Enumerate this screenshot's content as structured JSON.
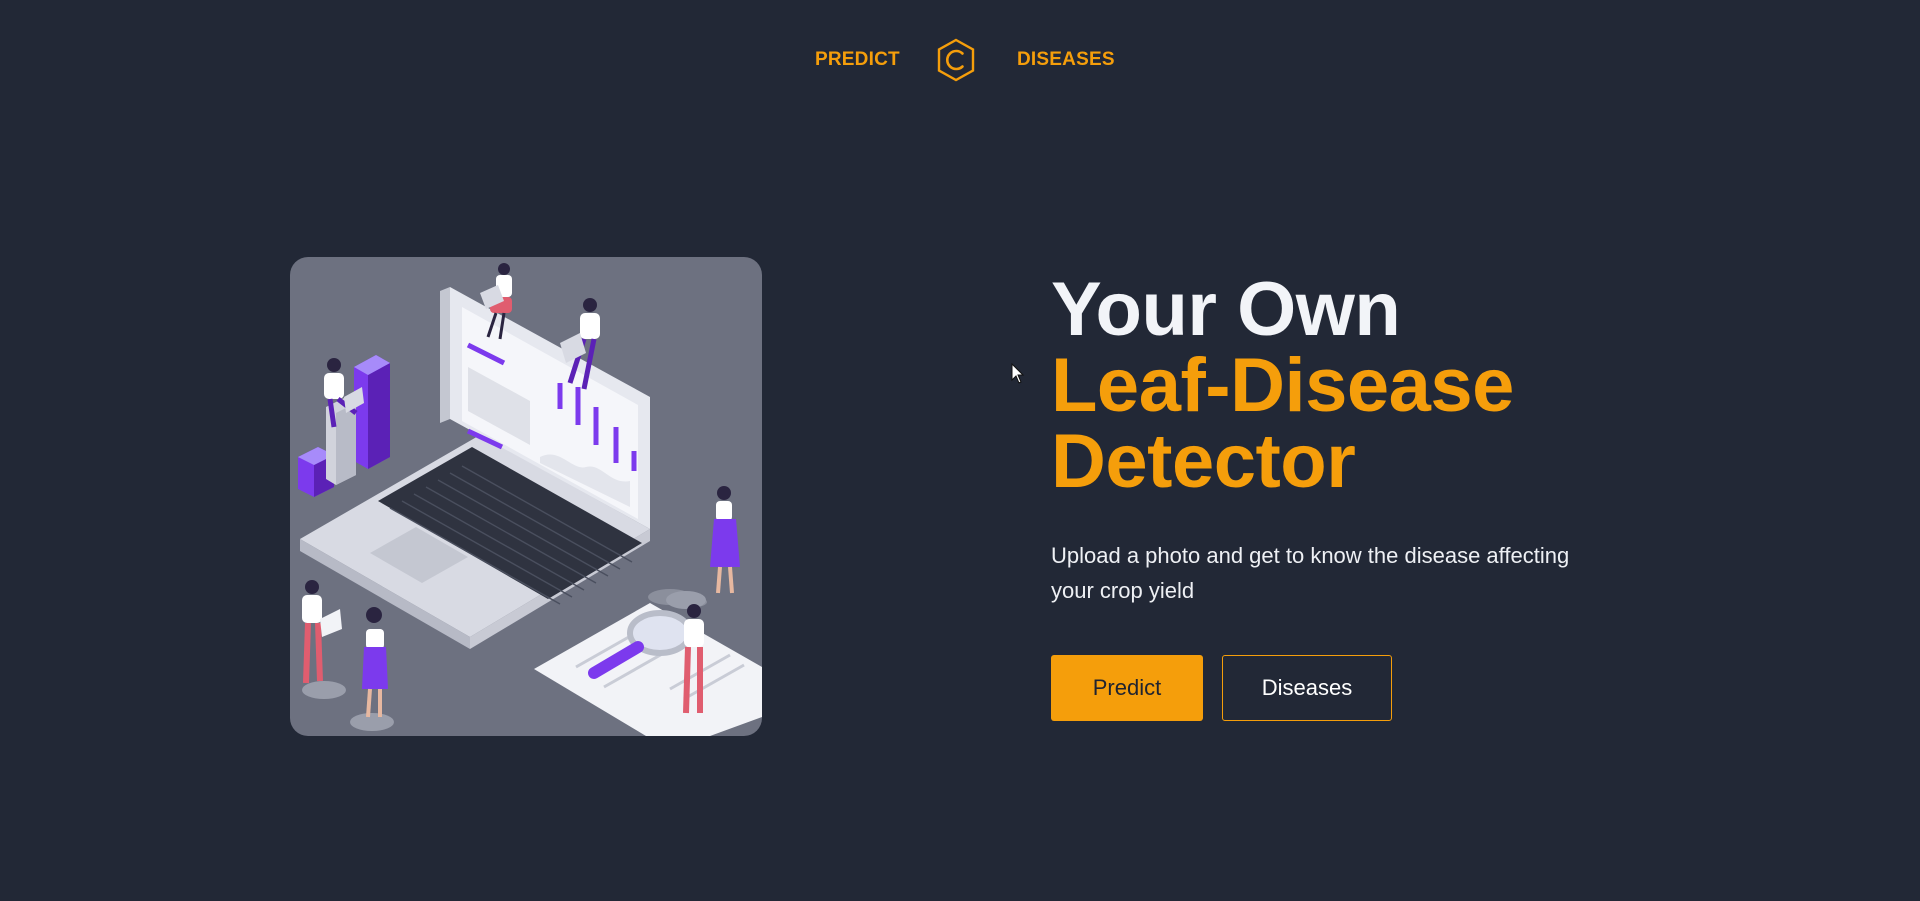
{
  "nav": {
    "predict_label": "PREDICT",
    "diseases_label": "DISEASES",
    "logo_icon": "hexagon-c-logo-icon"
  },
  "hero": {
    "title_line1": "Your Own",
    "title_line2": "Leaf-Disease",
    "title_line3": "Detector",
    "subtitle": "Upload a photo and get to know the disease affecting your crop yield",
    "illustration": "isometric-laptop-people-illustration"
  },
  "buttons": {
    "predict_label": "Predict",
    "diseases_label": "Diseases"
  },
  "colors": {
    "background": "#222836",
    "accent": "#f59e0b",
    "title_white": "#f2f4f8",
    "purple": "#7c3aed"
  }
}
